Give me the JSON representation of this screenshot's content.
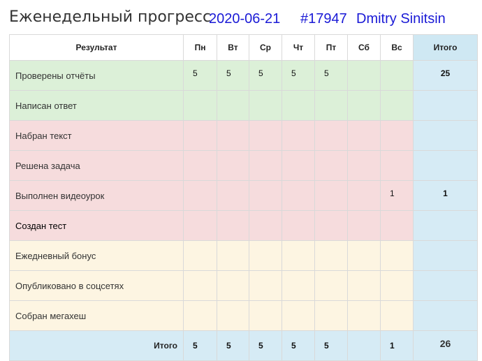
{
  "header": {
    "title": "Еженедельный прогресс",
    "date": "2020-06-21",
    "order": "#17947",
    "user": "Dmitry Sinitsin"
  },
  "table": {
    "columns": [
      "Результат",
      "Пн",
      "Вт",
      "Ср",
      "Чт",
      "Пт",
      "Сб",
      "Вс",
      "Итого"
    ],
    "rows": [
      {
        "label": "Проверены отчёты",
        "values": [
          "5",
          "5",
          "5",
          "5",
          "5",
          "",
          ""
        ],
        "total": "25",
        "group": "green"
      },
      {
        "label": "Написан ответ",
        "values": [
          "",
          "",
          "",
          "",
          "",
          "",
          ""
        ],
        "total": "",
        "group": "green"
      },
      {
        "label": "Набран текст",
        "values": [
          "",
          "",
          "",
          "",
          "",
          "",
          ""
        ],
        "total": "",
        "group": "red"
      },
      {
        "label": "Решена задача",
        "values": [
          "",
          "",
          "",
          "",
          "",
          "",
          ""
        ],
        "total": "",
        "group": "red"
      },
      {
        "label": "Выполнен видеоурок",
        "values": [
          "",
          "",
          "",
          "",
          "",
          "",
          "1"
        ],
        "total": "1",
        "group": "red"
      },
      {
        "label": "Создан тест",
        "values": [
          "",
          "",
          "",
          "",
          "",
          "",
          ""
        ],
        "total": "",
        "group": "red"
      },
      {
        "label": "Ежедневный бонус",
        "values": [
          "",
          "",
          "",
          "",
          "",
          "",
          ""
        ],
        "total": "",
        "group": "yellow"
      },
      {
        "label": "Опубликовано в соцсетях",
        "values": [
          "",
          "",
          "",
          "",
          "",
          "",
          ""
        ],
        "total": "",
        "group": "yellow"
      },
      {
        "label": "Собран мегахеш",
        "values": [
          "",
          "",
          "",
          "",
          "",
          "",
          ""
        ],
        "total": "",
        "group": "yellow"
      }
    ],
    "footer": {
      "label": "Итого",
      "values": [
        "5",
        "5",
        "5",
        "5",
        "5",
        "",
        "1"
      ],
      "total": "26"
    }
  },
  "colors": {
    "green": "#dcf0d8",
    "red": "#f6dcdd",
    "yellow": "#fdf5e2",
    "total": "#d6ebf5",
    "accent": "#1a1ad6"
  }
}
